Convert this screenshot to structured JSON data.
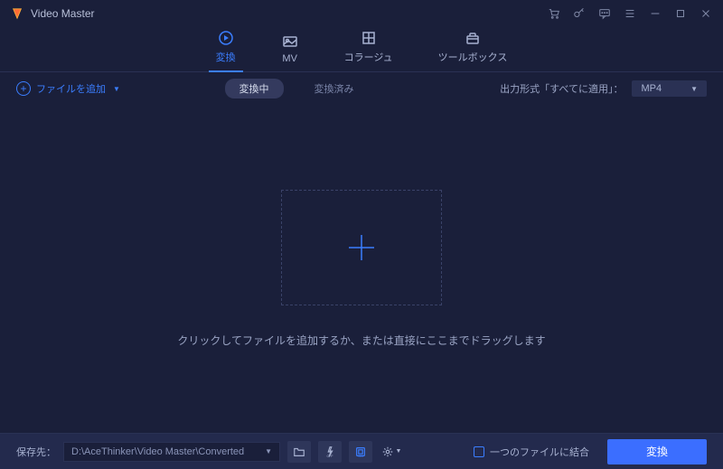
{
  "app": {
    "title": "Video Master"
  },
  "tabs": {
    "convert": "変換",
    "mv": "MV",
    "collage": "コラージュ",
    "toolbox": "ツールボックス"
  },
  "toolbar": {
    "add_file": "ファイルを追加",
    "status_converting": "変換中",
    "status_done": "変換済み",
    "output_label": "出力形式「すべてに適用」：",
    "output_format": "MP4"
  },
  "content": {
    "hint": "クリックしてファイルを追加するか、または直接にここまでドラッグします"
  },
  "bottom": {
    "save_label": "保存先：",
    "save_path": "D:\\AceThinker\\Video Master\\Converted",
    "merge_label": "一つのファイルに結合",
    "convert_btn": "変換"
  }
}
